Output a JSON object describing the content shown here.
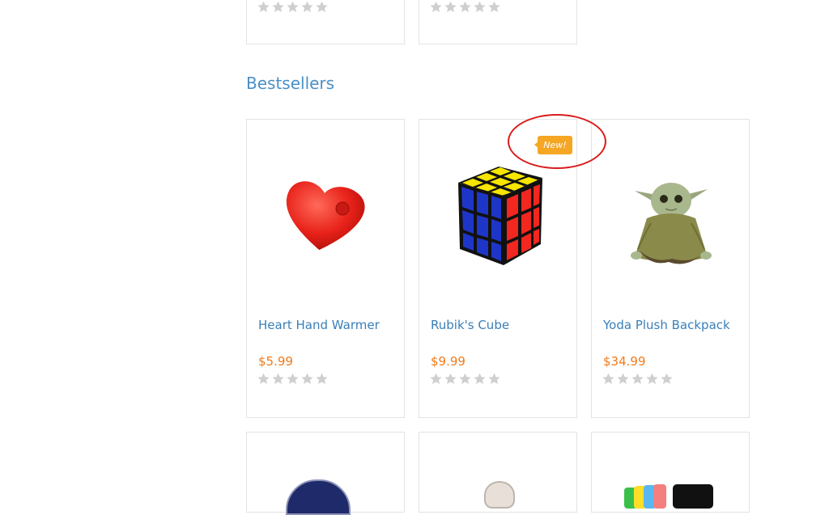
{
  "section": {
    "title": "Bestsellers"
  },
  "products": [
    {
      "name": "Heart Hand Warmer",
      "price": "$5.99"
    },
    {
      "name": "Rubik's Cube",
      "price": "$9.99",
      "badge": "New!"
    },
    {
      "name": "Yoda Plush Backpack",
      "price": "$34.99"
    }
  ],
  "colors": {
    "title": "#4a90c6",
    "name": "#3a7fb8",
    "price": "#f07a1a",
    "badge": "#f5a623",
    "highlight": "#d91c1c"
  },
  "icons": [
    "star-icon"
  ]
}
